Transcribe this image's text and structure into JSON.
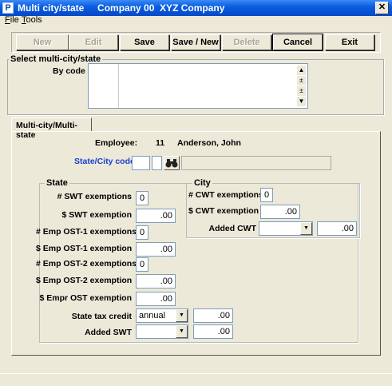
{
  "window": {
    "title": "Multi city/state",
    "company": "Company 00  XYZ Company",
    "close_glyph": "✕",
    "icon_letter": "P"
  },
  "menu": [
    {
      "underline": "F",
      "rest": "ile"
    },
    {
      "underline": "T",
      "rest": "ools"
    }
  ],
  "toolbar": {
    "new": "New",
    "edit": "Edit",
    "save": "Save",
    "save_new": "Save / New",
    "delete": "Delete",
    "cancel": "Cancel",
    "exit": "Exit"
  },
  "select_group": {
    "title": "Select multi-city/state",
    "by_code_label": "By code"
  },
  "tab": {
    "label": "Multi-city/Multi-state"
  },
  "employee": {
    "label": "Employee:",
    "number": "11",
    "name": "Anderson, John"
  },
  "state_city_code": {
    "label": "State/City code",
    "search_icon": "binoculars-icon"
  },
  "state": {
    "title": "State",
    "swt_exemptions_label": "# SWT exemptions",
    "swt_exemptions_value": "0",
    "swt_exemption_label": "$ SWT exemption",
    "swt_exemption_value": ".00",
    "emp_ost1_exemptions_label": "# Emp OST-1 exemptions",
    "emp_ost1_exemptions_value": "0",
    "emp_ost1_exemption_label": "$ Emp OST-1 exemption",
    "emp_ost1_exemption_value": ".00",
    "emp_ost2_exemptions_label": "# Emp OST-2 exemptions",
    "emp_ost2_exemptions_value": "0",
    "emp_ost2_exemption_label": "$ Emp OST-2 exemption",
    "emp_ost2_exemption_value": ".00",
    "empr_ost_exemption_label": "$ Empr OST exemption",
    "empr_ost_exemption_value": ".00",
    "state_tax_credit_label": "State tax credit",
    "state_tax_credit_select": "annual",
    "state_tax_credit_value": ".00",
    "added_swt_label": "Added SWT",
    "added_swt_select": "",
    "added_swt_value": ".00"
  },
  "city": {
    "title": "City",
    "cwt_exemptions_label": "# CWT exemptions",
    "cwt_exemptions_value": "0",
    "cwt_exemption_label": "$ CWT exemption",
    "cwt_exemption_value": ".00",
    "added_cwt_label": "Added CWT",
    "added_cwt_select": "",
    "added_cwt_value": ".00"
  },
  "scroll": {
    "up": "▲",
    "prev": "±",
    "next": "±",
    "down": "▼"
  },
  "dropdown_glyph": "▼"
}
